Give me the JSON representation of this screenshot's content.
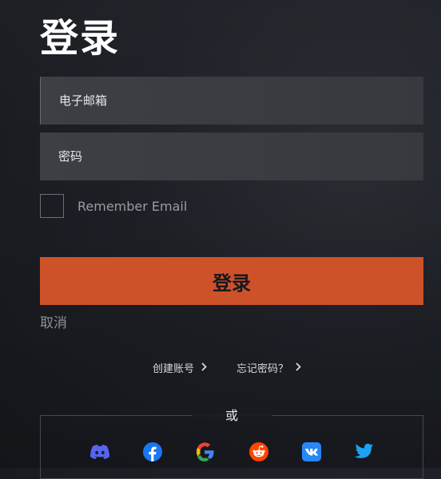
{
  "page": {
    "title": "登录"
  },
  "form": {
    "email_placeholder": "电子邮箱",
    "password_placeholder": "密码",
    "remember_label": "Remember Email",
    "login_label": "登录",
    "cancel_label": "取消"
  },
  "links": {
    "create_account": "创建账号",
    "forgot_password": "忘记密码？"
  },
  "social": {
    "or_label": "或",
    "providers": [
      "discord-icon",
      "facebook-icon",
      "google-icon",
      "reddit-icon",
      "vk-icon",
      "twitter-icon"
    ]
  },
  "colors": {
    "accent": "#cd522a",
    "discord": "#5865f2",
    "facebook": "#1877f2",
    "reddit": "#ff4500",
    "vk": "#2787f5",
    "twitter": "#1da1f2"
  }
}
